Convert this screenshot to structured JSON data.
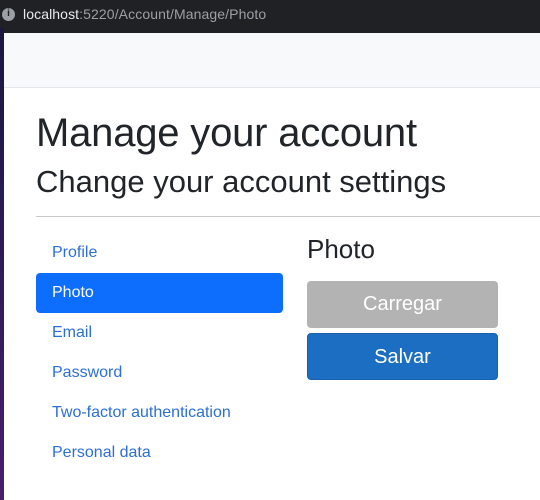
{
  "browser": {
    "url_host": "localhost",
    "url_rest": ":5220/Account/Manage/Photo",
    "info_icon": "info-icon"
  },
  "header": {
    "title": "Manage your account",
    "subtitle": "Change your account settings"
  },
  "sidebar": {
    "items": [
      {
        "label": "Profile"
      },
      {
        "label": "Photo"
      },
      {
        "label": "Email"
      },
      {
        "label": "Password"
      },
      {
        "label": "Two-factor authentication"
      },
      {
        "label": "Personal data"
      }
    ],
    "active": "Photo"
  },
  "main": {
    "heading": "Photo",
    "upload_label": "Carregar",
    "save_label": "Salvar"
  },
  "colors": {
    "accent": "#0d6efd",
    "link": "#2b6fd6",
    "save_button": "#1b6ec2",
    "upload_button": "#b3b3b3"
  }
}
